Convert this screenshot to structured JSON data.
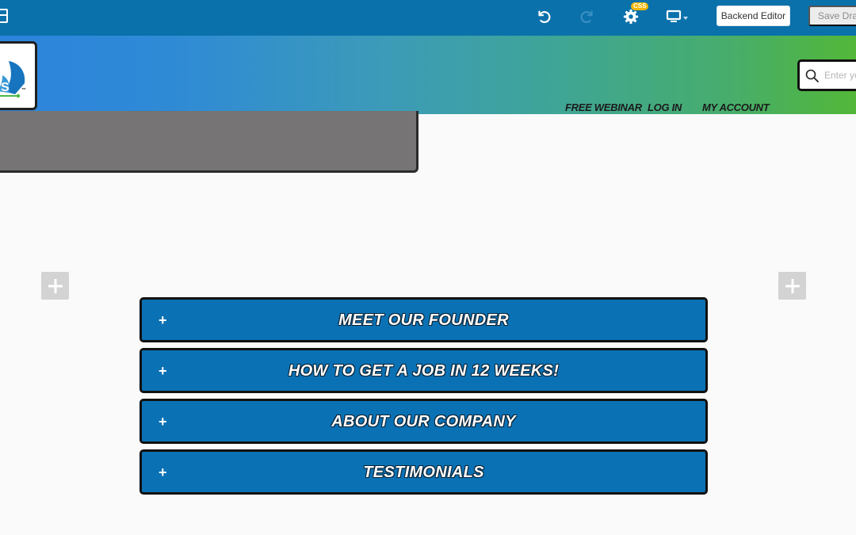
{
  "editor_toolbar": {
    "css_badge": "CSS",
    "backend_editor_label": "Backend Editor",
    "save_draft_label": "Save Draft"
  },
  "site_header": {
    "logo_mark": "™",
    "nav": {
      "free_webinar": "FREE WEBINAR",
      "log_in": "LOG IN",
      "my_account": "MY ACCOUNT"
    },
    "search": {
      "placeholder": "Enter your search"
    }
  },
  "accordion": {
    "items": [
      {
        "label": "MEET OUR FOUNDER"
      },
      {
        "label": "HOW TO GET A JOB IN 12 WEEKS!"
      },
      {
        "label": "ABOUT OUR COMPANY"
      },
      {
        "label": "TESTIMONIALS"
      }
    ]
  },
  "colors": {
    "toolbar_bg": "#0a71ab",
    "accordion_bg": "#0a71b4",
    "header_gradient_start": "#2c84dc",
    "header_gradient_end": "#52b738",
    "badge": "#f2b705"
  }
}
